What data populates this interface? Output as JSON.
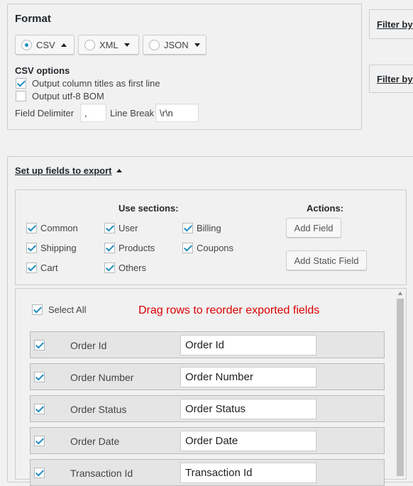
{
  "format": {
    "title": "Format",
    "options": [
      {
        "label": "CSV",
        "selected": true
      },
      {
        "label": "XML",
        "selected": false
      },
      {
        "label": "JSON",
        "selected": false
      }
    ],
    "csv_options_title": "CSV options",
    "output_column_titles": {
      "label": "Output column titles as first line",
      "checked": true
    },
    "output_bom": {
      "label": "Output utf-8 BOM",
      "checked": false
    },
    "field_delimiter_label": "Field Delimiter",
    "field_delimiter_value": ",",
    "line_break_label": "Line Break",
    "line_break_value": "\\r\\n"
  },
  "filters": {
    "filter1_label": "Filter by",
    "filter2_label": "Filter by"
  },
  "setup": {
    "title": "Set up fields to export",
    "use_sections_title": "Use sections:",
    "sections": [
      {
        "label": "Common",
        "checked": true
      },
      {
        "label": "User",
        "checked": true
      },
      {
        "label": "Billing",
        "checked": true
      },
      {
        "label": "Shipping",
        "checked": true
      },
      {
        "label": "Products",
        "checked": true
      },
      {
        "label": "Coupons",
        "checked": true
      },
      {
        "label": "Cart",
        "checked": true
      },
      {
        "label": "Others",
        "checked": true
      }
    ],
    "actions_title": "Actions:",
    "add_field_label": "Add Field",
    "add_static_field_label": "Add Static Field"
  },
  "fields": {
    "select_all_label": "Select All",
    "drag_hint": "Drag rows to reorder exported fields",
    "drag_hint_color": "#dd0000",
    "rows": [
      {
        "label": "Order Id",
        "value": "Order Id",
        "checked": true
      },
      {
        "label": "Order Number",
        "value": "Order Number",
        "checked": true
      },
      {
        "label": "Order Status",
        "value": "Order Status",
        "checked": true
      },
      {
        "label": "Order Date",
        "value": "Order Date",
        "checked": true
      },
      {
        "label": "Transaction Id",
        "value": "Transaction Id",
        "checked": true
      }
    ]
  }
}
